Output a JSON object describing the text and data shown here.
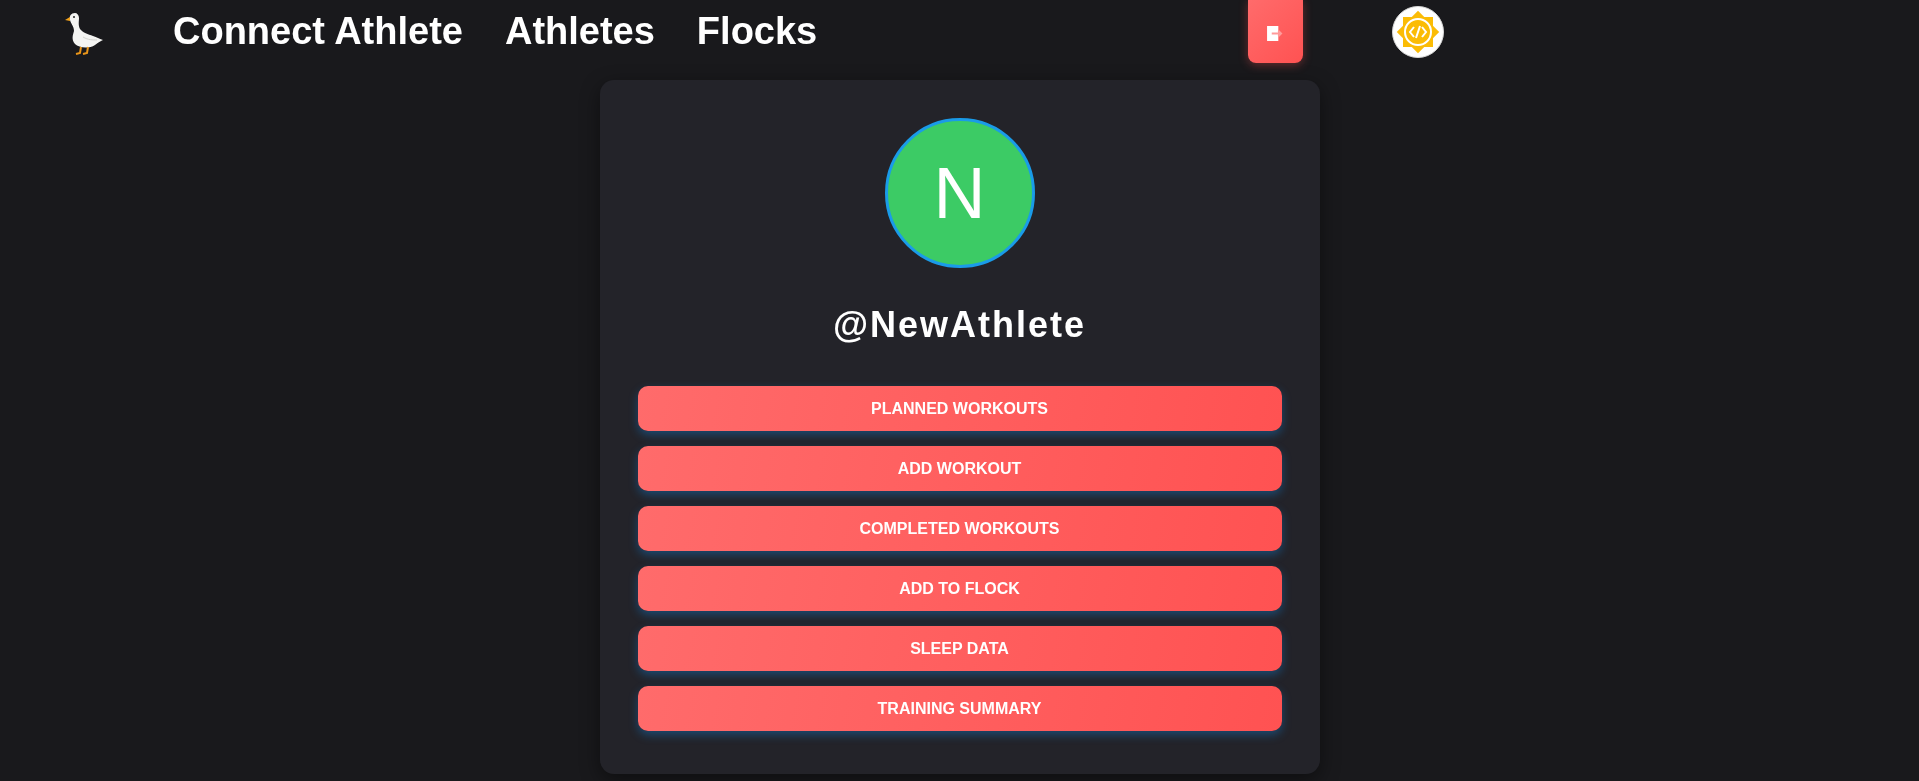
{
  "header": {
    "nav": [
      {
        "label": "Connect Athlete"
      },
      {
        "label": "Athletes"
      },
      {
        "label": "Flocks"
      }
    ]
  },
  "profile": {
    "initial": "N",
    "username": "@NewAthlete"
  },
  "actions": [
    {
      "label": "PLANNED WORKOUTS"
    },
    {
      "label": "ADD WORKOUT"
    },
    {
      "label": "COMPLETED WORKOUTS"
    },
    {
      "label": "ADD TO FLOCK"
    },
    {
      "label": "SLEEP DATA"
    },
    {
      "label": "TRAINING SUMMARY"
    }
  ]
}
